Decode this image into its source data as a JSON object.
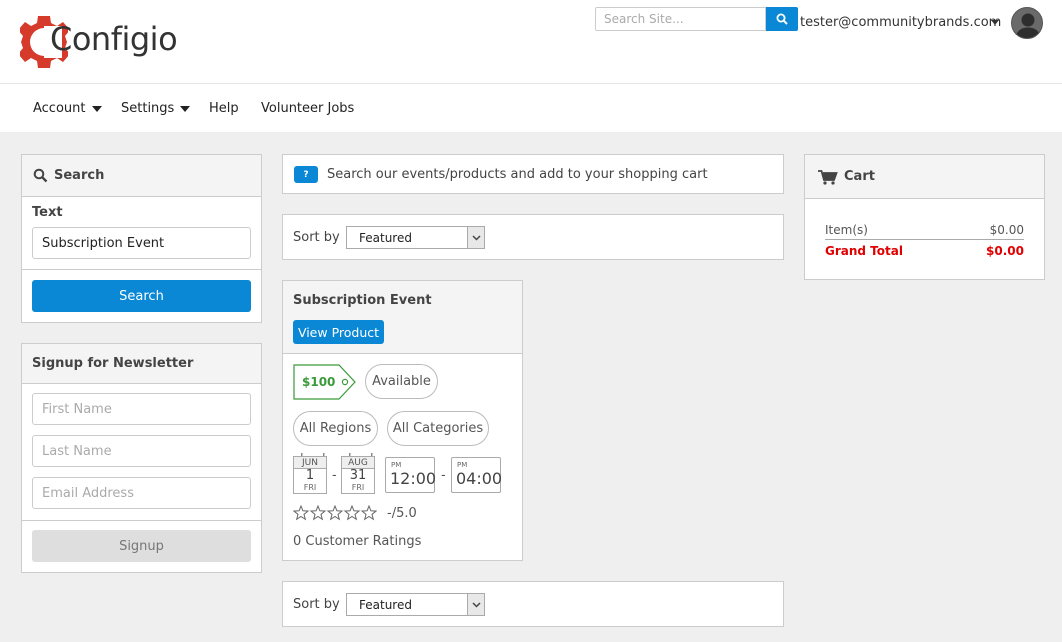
{
  "header": {
    "logo_text": "Configio",
    "search_placeholder": "Search Site...",
    "user_email": "tester@communitybrands.com"
  },
  "nav": {
    "items": [
      {
        "label": "Account",
        "has_caret": true
      },
      {
        "label": "Settings",
        "has_caret": true
      },
      {
        "label": "Help",
        "has_caret": false
      },
      {
        "label": "Volunteer Jobs",
        "has_caret": false
      }
    ]
  },
  "search_panel": {
    "title": "Search",
    "text_label": "Text",
    "text_value": "Subscription Event",
    "button_label": "Search"
  },
  "newsletter": {
    "title": "Signup for Newsletter",
    "first_name_placeholder": "First Name",
    "last_name_placeholder": "Last Name",
    "email_placeholder": "Email Address",
    "button_label": "Signup"
  },
  "info_bar": {
    "badge": "?",
    "text": "Search our events/products and add to your shopping cart"
  },
  "sort": {
    "label": "Sort by",
    "selected": "Featured"
  },
  "product": {
    "title": "Subscription Event",
    "view_button": "View Product",
    "price": "$100",
    "availability": "Available",
    "region": "All Regions",
    "category": "All Categories",
    "start_date": {
      "month": "JUN",
      "day": "1",
      "dow": "FRI"
    },
    "end_date": {
      "month": "AUG",
      "day": "31",
      "dow": "FRI"
    },
    "date_separator": "-",
    "start_time": {
      "ampm": "PM",
      "time": "12:00"
    },
    "end_time": {
      "ampm": "PM",
      "time": "04:00"
    },
    "time_separator": "-",
    "rating_text": "-/5.0",
    "rating_stars": 0,
    "ratings_count": "0 Customer Ratings"
  },
  "cart": {
    "title": "Cart",
    "items_label": "Item(s)",
    "items_value": "$0.00",
    "grand_total_label": "Grand Total",
    "grand_total_value": "$0.00"
  },
  "colors": {
    "accent": "#0a88d6",
    "price_green": "#3a9a3a",
    "grand_total_red": "#e00000",
    "logo_red": "#d63a2a"
  }
}
